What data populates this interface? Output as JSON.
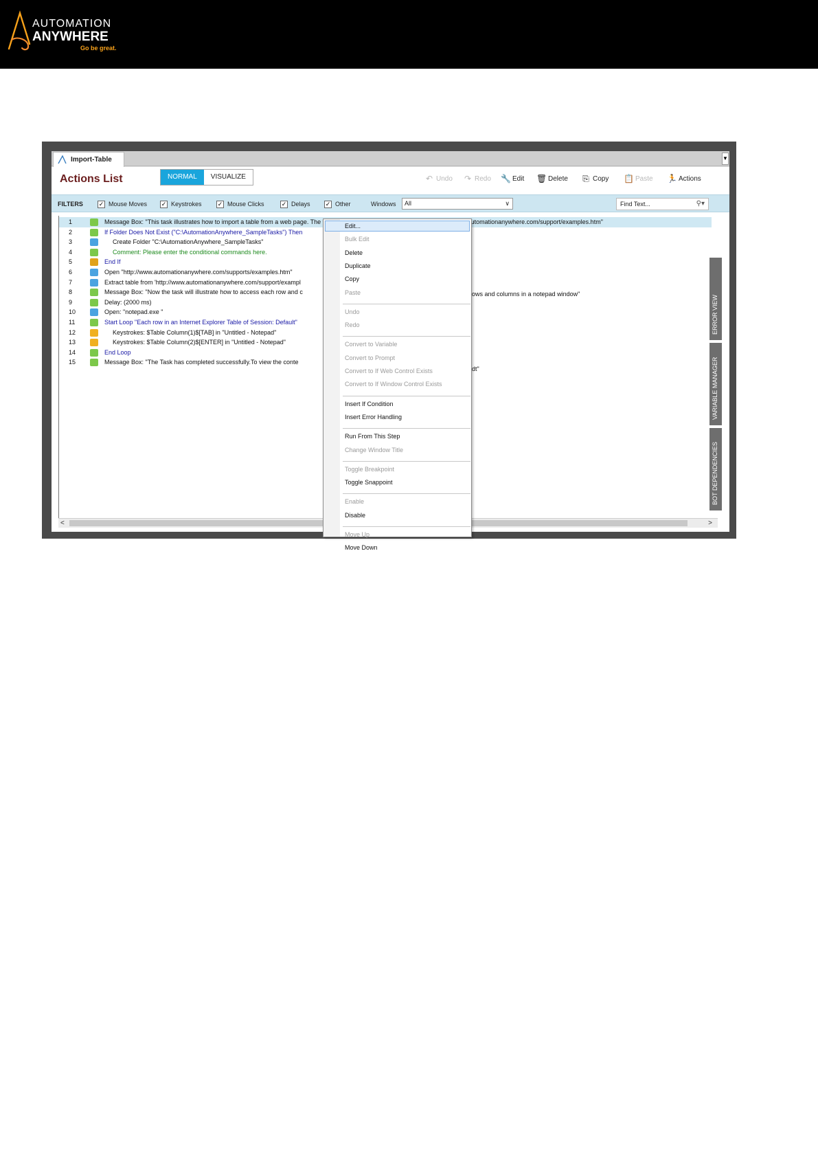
{
  "brand": {
    "logo_line1": "AUTOMATION",
    "logo_line2": "ANYWHERE",
    "tagline": "Go be great.",
    "accent": "#f7a11a",
    "logo_icon": "automation-anywhere-a-icon"
  },
  "window": {
    "tab_title": "Import-Table",
    "page_title": "Actions List",
    "view_modes": [
      "NORMAL",
      "VISUALIZE"
    ],
    "active_view": "NORMAL",
    "accent": "#1aa5dc"
  },
  "toolbar": {
    "undo": "Undo",
    "redo": "Redo",
    "edit": "Edit",
    "delete": "Delete",
    "copy": "Copy",
    "paste": "Paste",
    "actions": "Actions"
  },
  "filters": {
    "label": "FILTERS",
    "items": [
      "Mouse Moves",
      "Keystrokes",
      "Mouse Clicks",
      "Delays",
      "Other"
    ],
    "checked": true,
    "windows_label": "Windows",
    "windows_value": "All",
    "find_placeholder": "Find Text..."
  },
  "actions": [
    {
      "num": "1",
      "text": "Message Box: \"This task illustrates how to import a table from a web page. The task imports the Sample Tasks table from http://www.automationanywhere.com/support/examples.htm\"",
      "icon": "message-box-icon",
      "color": "black"
    },
    {
      "num": "2",
      "text": "If Folder Does Not Exist (\"C:\\AutomationAnywhere_SampleTasks\")  Then",
      "icon": "if-icon",
      "color": "blue"
    },
    {
      "num": "3",
      "text": "Create Folder \"C:\\AutomationAnywhere_SampleTasks\"",
      "icon": "folder-icon",
      "color": "black"
    },
    {
      "num": "4",
      "text": "Comment: Please enter the conditional commands here.",
      "icon": "comment-icon",
      "color": "green"
    },
    {
      "num": "5",
      "text": "End If",
      "icon": "end-if-icon",
      "color": "blue"
    },
    {
      "num": "6",
      "text": "Open \"http://www.automationanywhere.com/supports/examples.htm\"",
      "icon": "web-recorder-icon",
      "color": "black"
    },
    {
      "num": "7",
      "text": "Extract table from 'http://www.automationanywhere.com/support/exampl",
      "icon": "web-recorder-icon",
      "color": "black"
    },
    {
      "num": "8",
      "text": "Message Box: \"Now the task will illustrate how to access each row and c",
      "icon": "message-box-icon",
      "color": "black"
    },
    {
      "num": "9",
      "text": "Delay: (2000 ms)",
      "icon": "delay-icon",
      "color": "black"
    },
    {
      "num": "10",
      "text": "Open: \"notepad.exe \"",
      "icon": "open-folder-icon",
      "color": "black"
    },
    {
      "num": "11",
      "text": "Start Loop \"Each row in an Internet Explorer Table of Session: Default\"",
      "icon": "loop-icon",
      "color": "blue"
    },
    {
      "num": "12",
      "text": "Keystrokes: $Table Column(1)$[TAB] in \"Untitled - Notepad\"",
      "icon": "keystrokes-icon",
      "color": "black"
    },
    {
      "num": "13",
      "text": "Keystrokes: $Table Column(2)$[ENTER] in \"Untitled - Notepad\"",
      "icon": "keystrokes-icon",
      "color": "black"
    },
    {
      "num": "14",
      "text": "End Loop",
      "icon": "end-loop-icon",
      "color": "blue"
    },
    {
      "num": "15",
      "text": "Message Box: \"The Task has completed successfully.To view the conte",
      "icon": "message-box-icon",
      "color": "black"
    }
  ],
  "overflow_text": {
    "row8_tail": "ows and columns in a notepad window\"",
    "row15_tail": "dt\""
  },
  "side_tabs": [
    "ERROR VIEW",
    "VARIABLE MANAGER",
    "BOT DEPENDENCIES"
  ],
  "context_menu": {
    "items": [
      {
        "label": "Edit...",
        "enabled": true,
        "highlighted": true
      },
      {
        "label": "Bulk Edit",
        "enabled": false
      },
      {
        "label": "Delete",
        "enabled": true
      },
      {
        "label": "Duplicate",
        "enabled": true
      },
      {
        "label": "Copy",
        "enabled": true
      },
      {
        "label": "Paste",
        "enabled": false
      },
      {
        "label": "Undo",
        "enabled": false
      },
      {
        "label": "Redo",
        "enabled": false
      },
      {
        "label": "Convert to Variable",
        "enabled": false
      },
      {
        "label": "Convert to Prompt",
        "enabled": false
      },
      {
        "label": "Convert to If Web Control Exists",
        "enabled": false
      },
      {
        "label": "Convert to If Window Control Exists",
        "enabled": false
      },
      {
        "label": "Insert If Condition",
        "enabled": true
      },
      {
        "label": "Insert Error Handling",
        "enabled": true
      },
      {
        "label": "Run From This Step",
        "enabled": true
      },
      {
        "label": "Change Window Title",
        "enabled": false
      },
      {
        "label": "Toggle Breakpoint",
        "enabled": false
      },
      {
        "label": "Toggle Snappoint",
        "enabled": true
      },
      {
        "label": "Enable",
        "enabled": false
      },
      {
        "label": "Disable",
        "enabled": true
      },
      {
        "label": "Move Up",
        "enabled": false
      },
      {
        "label": "Move Down",
        "enabled": true
      }
    ]
  }
}
